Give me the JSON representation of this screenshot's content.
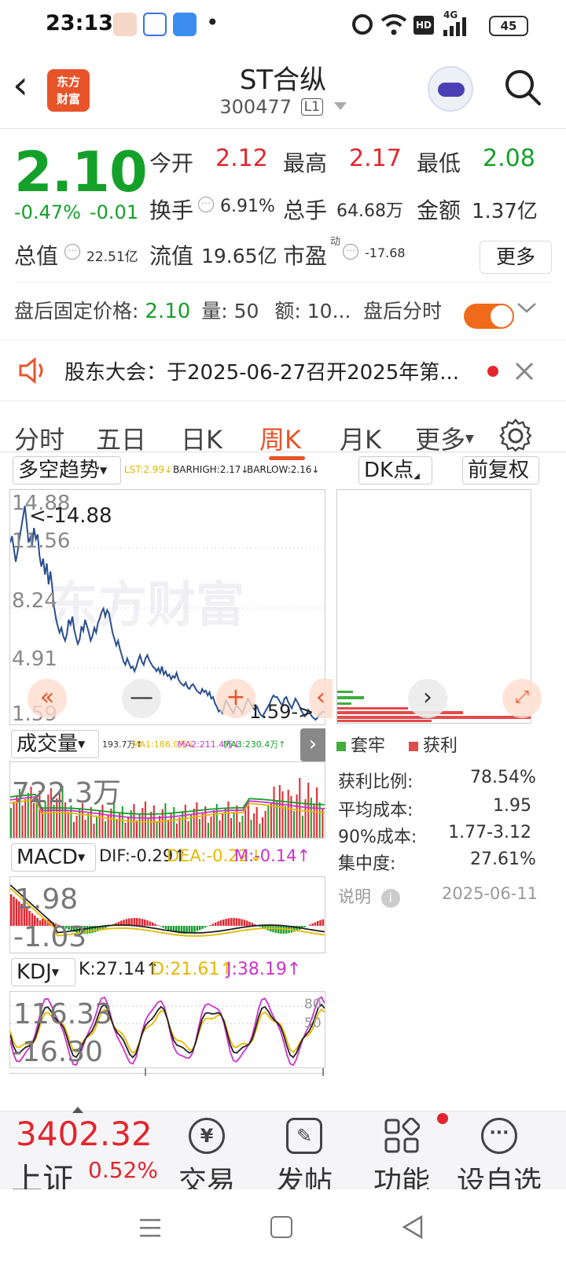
{
  "status_bar": {
    "time": "23:13",
    "dot": "•",
    "network": "4G",
    "hd": "HD",
    "battery": "45"
  },
  "header": {
    "back_glyph": "‹",
    "logo_line1": "东方",
    "logo_line2": "财富",
    "stock_name": "ST合纵",
    "stock_code": "300477",
    "level": "L1"
  },
  "quote": {
    "price": "2.10",
    "change_pct": "-0.47%",
    "change": "-0.01",
    "open_label": "今开",
    "open": "2.12",
    "high_label": "最高",
    "high": "2.17",
    "low_label": "最低",
    "low": "2.08",
    "turnover_label": "换手",
    "turnover": "6.91%",
    "volume_label": "总手",
    "volume": "64.68万",
    "amount_label": "金额",
    "amount": "1.37亿",
    "mktcap_label": "总值",
    "mktcap": "22.51亿",
    "float_label": "流值",
    "float_cap": "19.65亿",
    "pe_label": "市盈",
    "pe_sup": "动",
    "pe": "-17.68",
    "more_label": "更多"
  },
  "after_hours": {
    "price_label": "盘后固定价格:",
    "price": "2.10",
    "vol_label": "量:",
    "vol": "50",
    "amt_label": "额:",
    "amt": "10...",
    "toggle_label": "盘后分时"
  },
  "notice": {
    "text": "股东大会：于2025-06-27召开2025年第..."
  },
  "tabs": {
    "items": [
      "分时",
      "五日",
      "日K",
      "周K",
      "月K",
      "更多"
    ],
    "active": "周K"
  },
  "kchart": {
    "indicator": "多空趋势",
    "lst": "LST:2.99↓",
    "barhigh": "BARHIGH:2.17↓",
    "barlow": "BARLOW:2.16↓",
    "dk_label": "DK点",
    "adjust_label": "前复权",
    "y_labels": [
      "14.88",
      "11.56",
      "8.24",
      "4.91",
      "1.59"
    ],
    "max_annot": "<-14.88",
    "min_annot": "1.59->",
    "watermark": "东方财富",
    "series": [
      12.6,
      13.0,
      12.2,
      11.4,
      12.0,
      12.8,
      13.5,
      14.2,
      14.88,
      13.8,
      12.6,
      12.9,
      12.4,
      13.5,
      12.8,
      13.1,
      11.8,
      11.1,
      11.6,
      10.6,
      11.3,
      10.0,
      10.8,
      9.8,
      8.6,
      7.9,
      7.4,
      7.0,
      7.3,
      6.8,
      6.5,
      6.9,
      7.8,
      7.5,
      8.0,
      7.2,
      6.7,
      6.3,
      6.6,
      7.4,
      7.1,
      7.8,
      7.4,
      7.0,
      6.5,
      6.8,
      7.3,
      7.0,
      7.6,
      7.9,
      8.3,
      8.5,
      8.0,
      8.4,
      8.2,
      7.6,
      7.0,
      6.6,
      6.2,
      6.5,
      6.0,
      5.6,
      5.2,
      5.0,
      5.4,
      5.1,
      4.8,
      4.9,
      4.6,
      4.9,
      5.3,
      5.6,
      5.2,
      5.0,
      5.4,
      5.6,
      5.3,
      5.1,
      4.9,
      4.8,
      4.6,
      4.8,
      4.5,
      4.9,
      4.4,
      4.6,
      4.3,
      4.4,
      4.1,
      4.3,
      4.2,
      4.5,
      4.1,
      3.9,
      3.8,
      3.7,
      3.9,
      3.6,
      3.5,
      3.7,
      3.8,
      3.6,
      3.4,
      3.3,
      3.2,
      3.5,
      3.3,
      3.4,
      3.1,
      3.3,
      2.9,
      3.0,
      2.6,
      2.4,
      2.1,
      2.2,
      2.0,
      2.4,
      2.8,
      2.6,
      2.4,
      2.2,
      2.0,
      2.3,
      2.5,
      2.3,
      2.2,
      2.0,
      2.3,
      2.6,
      2.9,
      2.7,
      2.5,
      2.3,
      2.2,
      2.4,
      2.1,
      1.9,
      1.8,
      2.0,
      2.2,
      2.4,
      2.6,
      2.9,
      3.1,
      3.0,
      3.0,
      2.8,
      2.6,
      2.5,
      2.9,
      3.0,
      2.7,
      2.5,
      2.3,
      2.6,
      2.9,
      2.7,
      2.5,
      2.2,
      2.0,
      1.8,
      1.9,
      2.2,
      2.0,
      1.8,
      1.7,
      1.59,
      1.7,
      1.9,
      2.0,
      2.1,
      2.1
    ]
  },
  "volume": {
    "label": "成交量",
    "vol": "193.7万↑",
    "ma1": "MA1:186.0万↓",
    "ma2": "MA2:211.4万↓",
    "ma3": "MA3:230.4万↑",
    "y_label": "722.3万"
  },
  "macd": {
    "label": "MACD",
    "dif": "DIF:-0.29↑",
    "dea": "DEA:-0.22↓",
    "m": "M:-0.14↑",
    "y_top": "1.98",
    "y_bot": "-1.03"
  },
  "kdj": {
    "label": "KDJ",
    "k": "K:27.14↑",
    "d": "D:21.61↑",
    "j": "J:38.19↑",
    "y_top": "116.33",
    "y_bot": "-16.30",
    "l80": "80",
    "l50": "50"
  },
  "dk_panel": {
    "legend_trapped": "套牢",
    "legend_profit": "获利",
    "profit_ratio_label": "获利比例:",
    "profit_ratio": "78.54%",
    "avg_cost_label": "平均成本:",
    "avg_cost": "1.95",
    "cost90_label": "90%成本:",
    "cost90": "1.77-3.12",
    "concentration_label": "集中度:",
    "concentration": "27.61%",
    "note_label": "说明",
    "date": "2025-06-11"
  },
  "bottom_bar": {
    "index_value": "3402.32",
    "index_name": "上证",
    "index_change": "0.52%",
    "nav": [
      "交易",
      "发帖",
      "功能",
      "设自选"
    ]
  },
  "colors": {
    "up": "#e2262f",
    "down": "#14a12a",
    "accent": "#e8542a",
    "line": "#2a4f8f"
  }
}
